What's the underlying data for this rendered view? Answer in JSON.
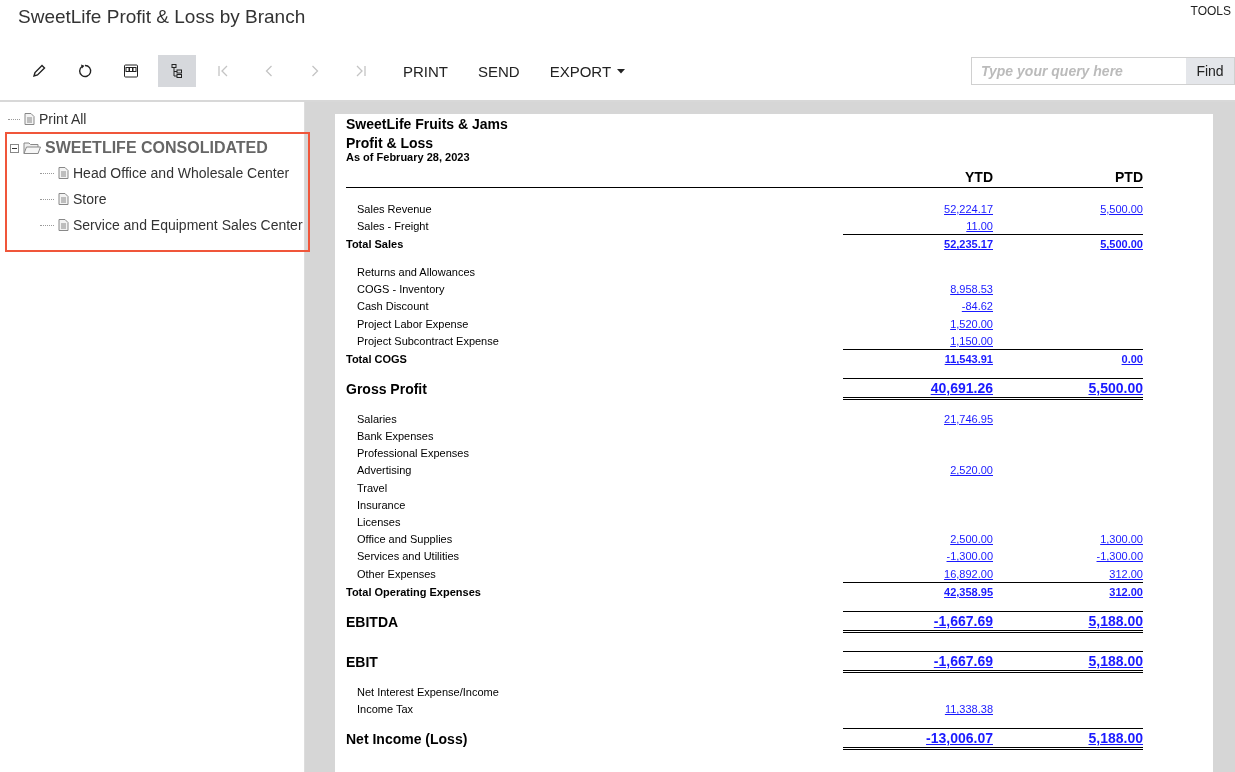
{
  "title": "SweetLife Profit & Loss by Branch",
  "tools_link": "TOOLS",
  "toolbar": [
    {
      "kind": "edit",
      "selected": false,
      "disabled": false
    },
    {
      "kind": "refresh",
      "selected": false,
      "disabled": false
    },
    {
      "kind": "pdf",
      "selected": false,
      "disabled": false
    },
    {
      "kind": "tree",
      "selected": true,
      "disabled": false
    },
    {
      "kind": "first",
      "selected": false,
      "disabled": true
    },
    {
      "kind": "prev",
      "selected": false,
      "disabled": true
    },
    {
      "kind": "next",
      "selected": false,
      "disabled": true
    },
    {
      "kind": "last",
      "selected": false,
      "disabled": true
    }
  ],
  "actions": [
    {
      "label": "PRINT",
      "dropdown": false
    },
    {
      "label": "SEND",
      "dropdown": false
    },
    {
      "label": "EXPORT",
      "dropdown": true
    }
  ],
  "search": {
    "placeholder": "Type your query here",
    "button": "Find"
  },
  "tree": [
    {
      "label": "Print All",
      "kind": "page",
      "selected": false
    },
    {
      "label": "SWEETLIFE CONSOLIDATED",
      "kind": "folder",
      "selected": true,
      "expanded": true,
      "children": [
        {
          "label": "Head Office and Wholesale Center",
          "kind": "page",
          "selected": false
        },
        {
          "label": "Store",
          "kind": "page",
          "selected": false
        },
        {
          "label": "Service and Equipment Sales Center",
          "kind": "page",
          "selected": false
        }
      ]
    }
  ],
  "report": {
    "company": "SweetLife Fruits & Jams",
    "name": "Profit & Loss",
    "date": "As of February 28, 2023",
    "columns": [
      "YTD",
      "PTD"
    ],
    "rows": [
      {
        "kind": "item",
        "label": "Sales Revenue",
        "ytd": "52,224.17",
        "ptd": "5,500.00"
      },
      {
        "kind": "item",
        "label": "Sales - Freight",
        "ytd": "11.00"
      },
      {
        "kind": "total",
        "label": "Total Sales",
        "ytd": "52,235.17",
        "ptd": "5,500.00"
      },
      {
        "kind": "item",
        "label": "Returns and Allowances"
      },
      {
        "kind": "item",
        "label": "COGS - Inventory",
        "ytd": "8,958.53"
      },
      {
        "kind": "item",
        "label": "Cash Discount",
        "ytd": "-84.62"
      },
      {
        "kind": "item",
        "label": "Project Labor Expense",
        "ytd": "1,520.00"
      },
      {
        "kind": "item",
        "label": "Project Subcontract Expense",
        "ytd": "1,150.00"
      },
      {
        "kind": "total",
        "label": "Total COGS",
        "ytd": "11,543.91",
        "ptd": "0.00"
      },
      {
        "kind": "major",
        "label": "Gross Profit",
        "ytd": "40,691.26",
        "ptd": "5,500.00"
      },
      {
        "kind": "item",
        "label": "Salaries",
        "ytd": "21,746.95"
      },
      {
        "kind": "item",
        "label": "Bank Expenses"
      },
      {
        "kind": "item",
        "label": "Professional Expenses"
      },
      {
        "kind": "item",
        "label": "Advertising",
        "ytd": "2,520.00"
      },
      {
        "kind": "item",
        "label": "Travel"
      },
      {
        "kind": "item",
        "label": "Insurance"
      },
      {
        "kind": "item",
        "label": "Licenses"
      },
      {
        "kind": "item",
        "label": "Office and Supplies",
        "ytd": "2,500.00",
        "ptd": "1,300.00"
      },
      {
        "kind": "item",
        "label": "Services and Utilities",
        "ytd": "-1,300.00",
        "ptd": "-1,300.00"
      },
      {
        "kind": "item",
        "label": "Other Expenses",
        "ytd": "16,892.00",
        "ptd": "312.00"
      },
      {
        "kind": "total",
        "label": "Total Operating Expenses",
        "ytd": "42,358.95",
        "ptd": "312.00"
      },
      {
        "kind": "major",
        "label": "EBITDA",
        "ytd": "-1,667.69",
        "ptd": "5,188.00"
      },
      {
        "kind": "major",
        "label": "EBIT",
        "ytd": "-1,667.69",
        "ptd": "5,188.00"
      },
      {
        "kind": "item",
        "label": "Net Interest Expense/Income"
      },
      {
        "kind": "item",
        "label": "Income Tax",
        "ytd": "11,338.38"
      },
      {
        "kind": "major",
        "label": "Net Income (Loss)",
        "ytd": "-13,006.07",
        "ptd": "5,188.00"
      }
    ]
  }
}
